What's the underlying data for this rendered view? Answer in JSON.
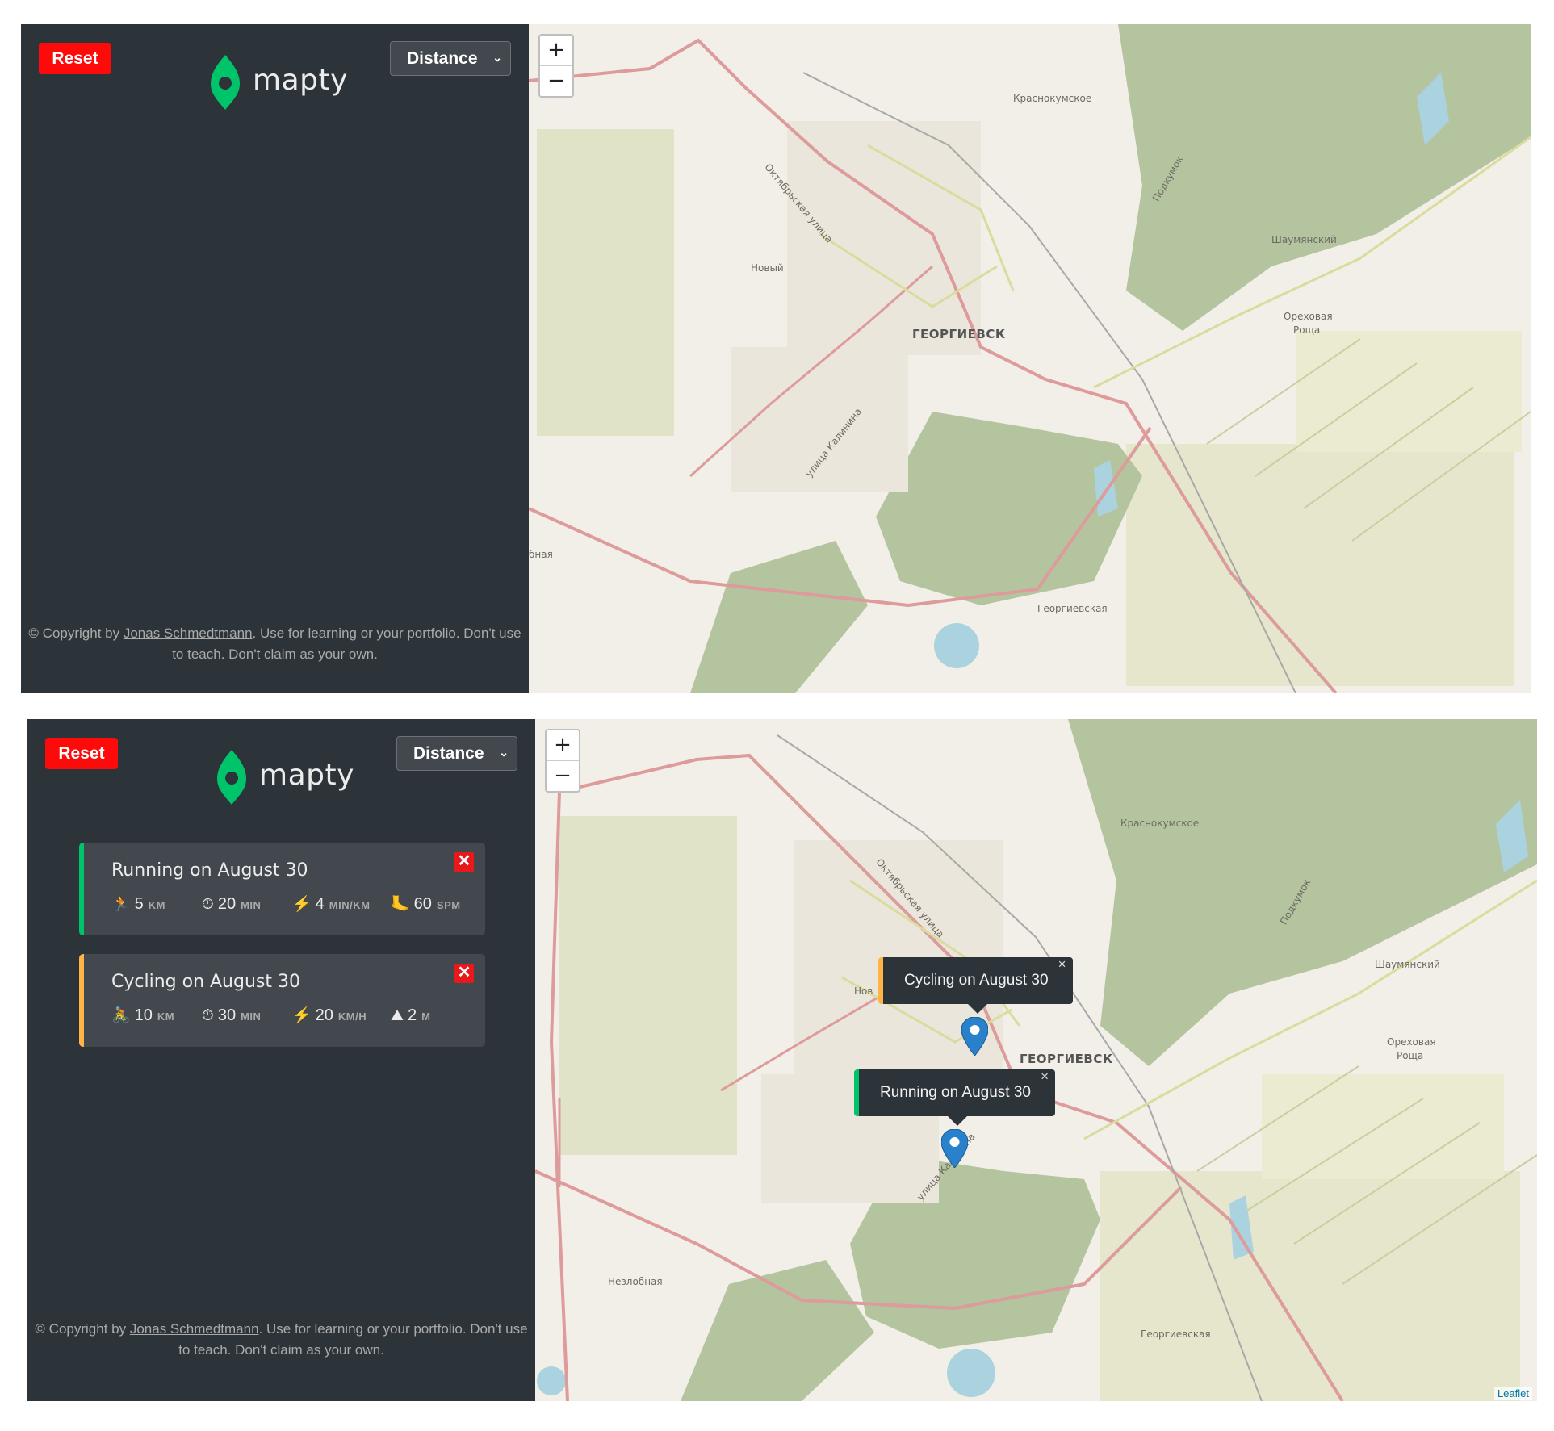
{
  "screens": [
    {
      "sidebar": {
        "reset_label": "Reset",
        "logo_text": "mapty",
        "sort": {
          "selected": "Distance"
        },
        "copyright": {
          "prefix": "© Copyright by ",
          "author": "Jonas Schmedtmann",
          "suffix": ". Use for learning or your portfolio. Don't use to teach. Don't claim as your own."
        }
      },
      "map": {
        "zoom_in": "+",
        "zoom_out": "−",
        "labels": {
          "city": "ГЕОРГИЕВСК",
          "krasnokum": "Краснокумское",
          "novy": "Новый",
          "shaum": "Шаумянский",
          "orekh1": "Ореховая",
          "orekh2": "Роща",
          "georg": "Георгиевская",
          "oktyabr": "Октябрьская улица",
          "kalinina": "улица Калинина",
          "podkumok": "Подкумок",
          "nezlob": "бная"
        }
      }
    },
    {
      "sidebar": {
        "reset_label": "Reset",
        "logo_text": "mapty",
        "sort": {
          "selected": "Distance"
        },
        "workouts": [
          {
            "type": "running",
            "title": "Running on August 30",
            "delete_label": "✕",
            "details": [
              {
                "icon": "🏃",
                "value": "5",
                "unit": "KM"
              },
              {
                "icon": "⏱",
                "value": "20",
                "unit": "MIN"
              },
              {
                "icon": "⚡️",
                "value": "4",
                "unit": "MIN/KM"
              },
              {
                "icon": "🦶",
                "value": "60",
                "unit": "SPM"
              }
            ]
          },
          {
            "type": "cycling",
            "title": "Cycling on August 30",
            "delete_label": "✕",
            "details": [
              {
                "icon": "🚴",
                "value": "10",
                "unit": "KM"
              },
              {
                "icon": "⏱",
                "value": "30",
                "unit": "MIN"
              },
              {
                "icon": "⚡️",
                "value": "20",
                "unit": "KM/H"
              },
              {
                "icon": "⛰",
                "value": "2",
                "unit": "M"
              }
            ]
          }
        ],
        "copyright": {
          "prefix": "© Copyright by ",
          "author": "Jonas Schmedtmann",
          "suffix": ". Use for learning or your portfolio. Don't use to teach. Don't claim as your own."
        }
      },
      "map": {
        "zoom_in": "+",
        "zoom_out": "−",
        "popups": {
          "cycling": {
            "text": "Cycling on August 30",
            "close": "×"
          },
          "running": {
            "text": "Running on August 30",
            "close": "×"
          }
        },
        "labels": {
          "city": "ГЕОРГИЕВСК",
          "krasnokum": "Краснокумское",
          "nov": "Нов",
          "shaum": "Шаумянский",
          "orekh1": "Ореховая",
          "orekh2": "Роща",
          "georg": "Георгиевская",
          "nezlob": "Незлобная",
          "oktyabr": "Октябрьская улица",
          "kalinina": "улица Калинина",
          "podkumok": "Подкумок"
        },
        "attribution": "Leaflet"
      }
    }
  ],
  "colors": {
    "sidebar_bg": "#2d3439",
    "card_bg": "#42484d",
    "running": "#00c46a",
    "cycling": "#ffb545",
    "reset": "#ff0a0a",
    "delete": "#e8191b"
  }
}
